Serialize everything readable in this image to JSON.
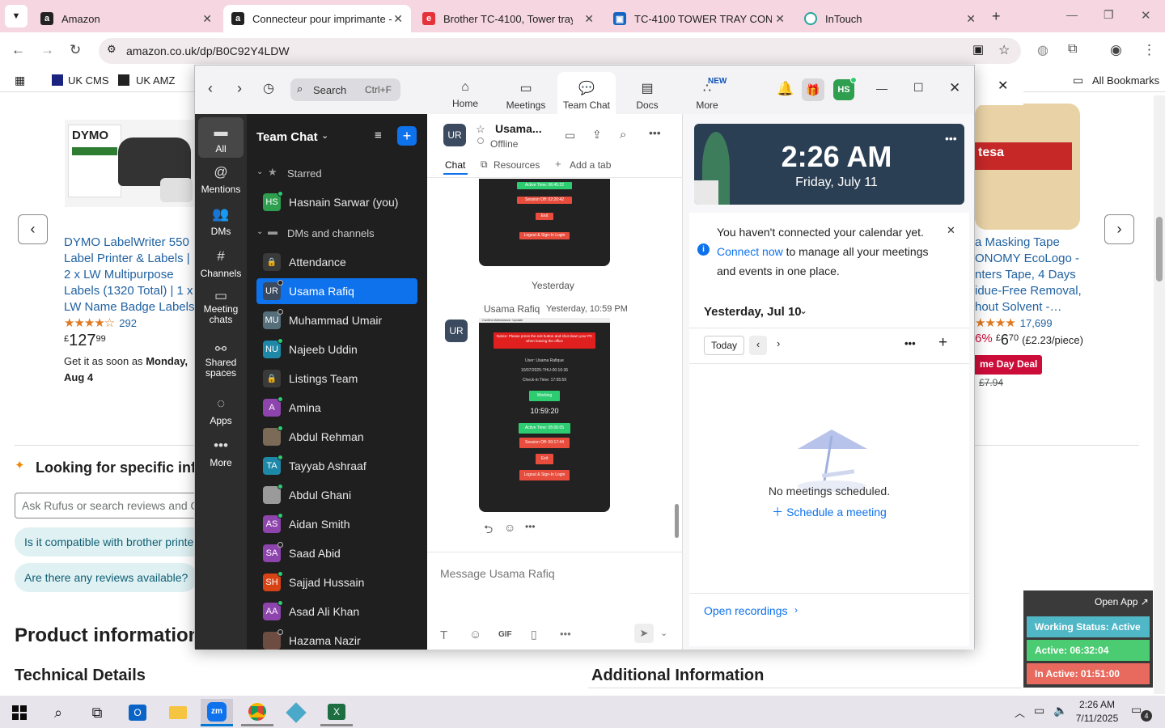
{
  "browser": {
    "tabs": [
      {
        "title": "Amazon",
        "icon": "amazon-icon",
        "active": false
      },
      {
        "title": "Connecteur pour imprimante -",
        "icon": "amazon-icon",
        "active": true
      },
      {
        "title": "Brother TC-4100, Tower tray co",
        "icon": "ebay-icon",
        "active": false
      },
      {
        "title": "TC-4100 TOWER TRAY CONNEC",
        "icon": "doc-icon",
        "active": false
      },
      {
        "title": "InTouch",
        "icon": "intouch-icon",
        "active": false
      }
    ],
    "url": "amazon.co.uk/dp/B0C92Y4LDW",
    "bookmarks": [
      {
        "label": "UK CMS"
      },
      {
        "label": "UK AMZ"
      }
    ],
    "all_bookmarks": "All Bookmarks"
  },
  "amazon": {
    "left_product": {
      "title": "DYMO LabelWriter 550 Label Printer & Labels | 2 x LW Multipurpose Labels (1320 Total) | 1 x LW Name Badge Labels (30…",
      "rating_count": "292",
      "price_currency": "£",
      "price_whole": "127",
      "price_fraction": "99",
      "delivery_prefix": "Get it as soon as",
      "delivery_date": "Monday, Aug 4",
      "brand_text": "DYMO"
    },
    "right_product": {
      "title_lines": [
        "a Masking Tape",
        "ONOMY EcoLogo -",
        "nters Tape, 4 Days",
        "idue-Free Removal,",
        "hout Solvent -…"
      ],
      "rating_count": "17,699",
      "discount": "6%",
      "price_currency": "£",
      "price_whole": "6",
      "price_fraction": "70",
      "unit_price": "(£2.23/piece)",
      "deal_badge": "me Day Deal",
      "was_price": "£7.94",
      "brand_text": "tesa"
    },
    "rufus_heading": "Looking for specific inf",
    "rufus_placeholder": "Ask Rufus or search reviews and Q",
    "suggestions": [
      "Is it compatible with brother printer",
      "Are there any reviews available?"
    ],
    "product_info_heading": "Product information",
    "technical_details": "Technical Details",
    "additional_info": "Additional Information"
  },
  "zoom": {
    "search_placeholder": "Search",
    "search_shortcut": "Ctrl+F",
    "nav": [
      {
        "label": "Home",
        "icon": "home-icon"
      },
      {
        "label": "Meetings",
        "icon": "video-icon"
      },
      {
        "label": "Team Chat",
        "icon": "chat-icon"
      },
      {
        "label": "Docs",
        "icon": "docs-icon"
      },
      {
        "label": "More",
        "icon": "more-icon"
      }
    ],
    "new_badge": "NEW",
    "user_initials": "HS",
    "rail": [
      {
        "label": "All",
        "icon": "chat-bubble-icon"
      },
      {
        "label": "Mentions",
        "icon": "at-icon"
      },
      {
        "label": "DMs",
        "icon": "people-icon"
      },
      {
        "label": "Channels",
        "icon": "hash-icon"
      },
      {
        "label": "Meeting chats",
        "icon": "calendar-chat-icon"
      },
      {
        "label": "Shared spaces",
        "icon": "shared-icon"
      },
      {
        "label": "Apps",
        "icon": "apps-icon"
      },
      {
        "label": "More",
        "icon": "ellipsis-icon"
      }
    ],
    "list_title": "Team Chat",
    "starred_label": "Starred",
    "dms_label": "DMs and channels",
    "starred": [
      {
        "name": "Hasnain Sarwar (you)",
        "initials": "HS",
        "color": "#2e9e4f",
        "status": "online"
      }
    ],
    "contacts": [
      {
        "name": "Attendance",
        "initials": "",
        "color": "#444",
        "status": "lock"
      },
      {
        "name": "Usama Rafiq",
        "initials": "UR",
        "color": "#3b4a5e",
        "status": "off",
        "selected": true
      },
      {
        "name": "Muhammad Umair",
        "initials": "MU",
        "color": "#546e7a",
        "status": "off"
      },
      {
        "name": "Najeeb Uddin",
        "initials": "NU",
        "color": "#1e88a8",
        "status": "online"
      },
      {
        "name": "Listings Team",
        "initials": "",
        "color": "#444",
        "status": "lock"
      },
      {
        "name": "Amina",
        "initials": "A",
        "color": "#8e44ad",
        "status": "online"
      },
      {
        "name": "Abdul Rehman",
        "initials": "",
        "color": "#7b6a55",
        "status": "online"
      },
      {
        "name": "Tayyab Ashraaf",
        "initials": "TA",
        "color": "#1e88a8",
        "status": "online"
      },
      {
        "name": "Abdul Ghani",
        "initials": "",
        "color": "#9a9a9a",
        "status": "online"
      },
      {
        "name": "Aidan Smith",
        "initials": "AS",
        "color": "#8e44ad",
        "status": "online"
      },
      {
        "name": "Saad Abid",
        "initials": "SA",
        "color": "#8e44ad",
        "status": "off"
      },
      {
        "name": "Sajjad Hussain",
        "initials": "SH",
        "color": "#d84315",
        "status": "online"
      },
      {
        "name": "Asad Ali Khan",
        "initials": "AA",
        "color": "#8e44ad",
        "status": "online"
      },
      {
        "name": "Hazama Nazir",
        "initials": "",
        "color": "#6d4c41",
        "status": "off"
      }
    ],
    "chat": {
      "contact_name": "Usama...",
      "contact_initials": "UR",
      "presence": "Offline",
      "tabs": [
        "Chat",
        "Resources",
        "Add a tab"
      ],
      "day_divider": "Yesterday",
      "message_sender": "Usama Rafiq",
      "message_time": "Yesterday, 10:59 PM",
      "composer_placeholder": "Message Usama Rafiq",
      "gif_label": "GIF",
      "shot1": {
        "active": "Active Time: 06:45:22",
        "session": "Session Off: 02:20:42",
        "exit": "Exit",
        "logout": "Logout & Sign-In Login"
      },
      "shot2": {
        "notice": "Notice: Please press the exit button and shut down your PC when leaving the office",
        "user": "User: Usama Rafique",
        "date": "10/07/2025-THU-00:16:36",
        "checkin": "Check-in Time: 17:55:59",
        "working": "Working",
        "clock": "10:59:20",
        "active": "Active Time: 05:06:05",
        "session": "Session Off: 00:17:44",
        "exit": "Exit",
        "logout": "Logout & Sign-In Login",
        "header": "Confirm Attendance: Update"
      }
    },
    "calendar": {
      "time": "2:26 AM",
      "date": "Friday, July 11",
      "notice_pre": "You haven't connected your calendar yet.",
      "notice_link": "Connect now",
      "notice_post": "to manage all your meetings and events in one place.",
      "day_heading": "Yesterday, Jul 10",
      "today_btn": "Today",
      "empty_text": "No meetings scheduled.",
      "schedule_link": "Schedule a meeting",
      "recordings": "Open recordings"
    }
  },
  "status_widget": {
    "open_app": "Open App ↗",
    "working": "Working Status: Active",
    "active": "Active: 06:32:04",
    "inactive": "In Active: 01:51:00"
  },
  "taskbar": {
    "time": "2:26 AM",
    "date": "7/11/2025",
    "notification_count": "4",
    "zoom_label": "zm"
  }
}
